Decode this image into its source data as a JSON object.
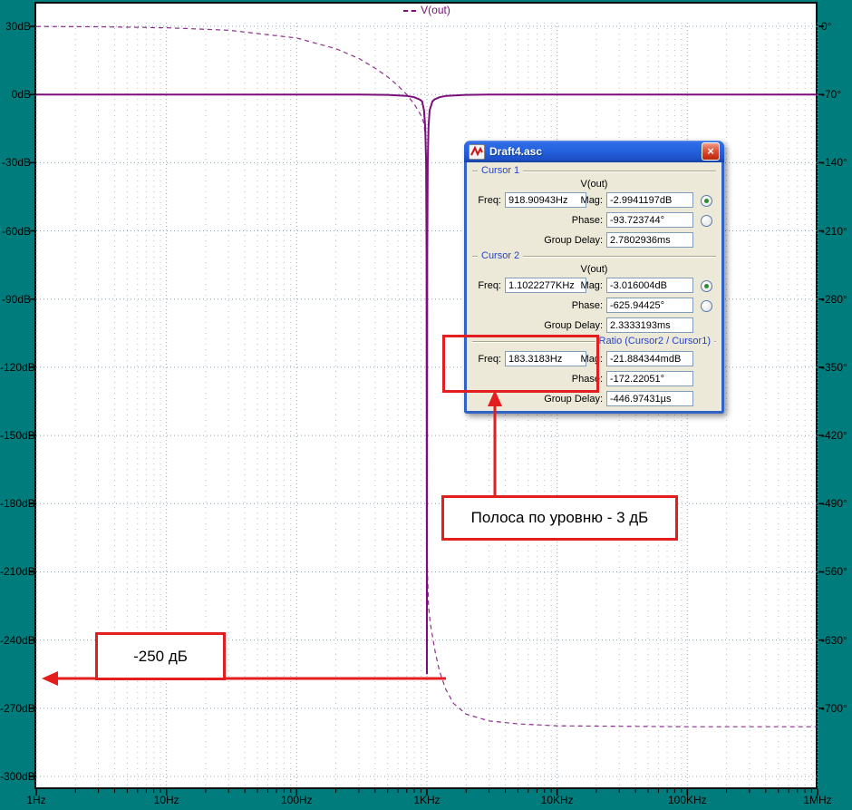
{
  "window": {
    "title": "Draft4.asc",
    "close_icon": "×"
  },
  "labels": {
    "freq": "Freq:",
    "mag": "Mag:",
    "phase": "Phase:",
    "group_delay": "Group Delay:"
  },
  "cursor1": {
    "section_label": "Cursor 1",
    "trace": "V(out)",
    "freq": "918.90943Hz",
    "mag": "-2.9941197dB",
    "mag_selected": true,
    "phase": "-93.723744°",
    "phase_selected": false,
    "group_delay": "2.7802936ms"
  },
  "cursor2": {
    "section_label": "Cursor 2",
    "trace": "V(out)",
    "freq": "1.1022277KHz",
    "mag": "-3.016004dB",
    "mag_selected": true,
    "phase": "-625.94425°",
    "phase_selected": false,
    "group_delay": "2.3333193ms"
  },
  "ratio": {
    "section_label": "Ratio (Cursor2 / Cursor1)",
    "freq": "183.3183Hz",
    "mag": "-21.884344mdB",
    "phase": "-172.22051°",
    "group_delay": "-446.97431µs"
  },
  "annotations": {
    "bandwidth_label": "Полоса по уровню - 3 дБ",
    "level_label": "-250 дБ"
  },
  "colors": {
    "background_teal": "#007C7C",
    "trace": "#7B0E7B",
    "trace_phase": "#8B2F8B",
    "annotation_red": "#E31E1E",
    "dialog_bg": "#ECE9D8",
    "section_header_blue": "#2743C9"
  },
  "chart_data": {
    "type": "line",
    "title": "V(out)",
    "x_axis": {
      "scale": "log",
      "range_hz": [
        1,
        1000000
      ],
      "ticks": [
        {
          "v": 1,
          "label": "1Hz"
        },
        {
          "v": 10,
          "label": "10Hz"
        },
        {
          "v": 100,
          "label": "100Hz"
        },
        {
          "v": 1000,
          "label": "1KHz"
        },
        {
          "v": 10000,
          "label": "10KHz"
        },
        {
          "v": 100000,
          "label": "100KHz"
        },
        {
          "v": 1000000,
          "label": "1MHz"
        }
      ]
    },
    "y_left": {
      "unit": "dB",
      "range": [
        30,
        -300
      ],
      "ticks": [
        {
          "v": 30,
          "label": "30dB"
        },
        {
          "v": 0,
          "label": "0dB"
        },
        {
          "v": -30,
          "label": "-30dB"
        },
        {
          "v": -60,
          "label": "-60dB"
        },
        {
          "v": -90,
          "label": "-90dB"
        },
        {
          "v": -120,
          "label": "-120dB"
        },
        {
          "v": -150,
          "label": "-150dB"
        },
        {
          "v": -180,
          "label": "-180dB"
        },
        {
          "v": -210,
          "label": "-210dB"
        },
        {
          "v": -240,
          "label": "-240dB"
        },
        {
          "v": -270,
          "label": "-270dB"
        },
        {
          "v": -300,
          "label": "-300dB"
        }
      ]
    },
    "y_right": {
      "unit": "degrees",
      "degrees_per_gridline": 70,
      "ticks": [
        {
          "v": 0,
          "label": "0°"
        },
        {
          "v": -70,
          "label": "-70°"
        },
        {
          "v": -140,
          "label": "-140°"
        },
        {
          "v": -210,
          "label": "-210°"
        },
        {
          "v": -280,
          "label": "-280°"
        },
        {
          "v": -350,
          "label": "-350°"
        },
        {
          "v": -420,
          "label": "-420°"
        },
        {
          "v": -490,
          "label": "-490°"
        },
        {
          "v": -560,
          "label": "-560°"
        },
        {
          "v": -630,
          "label": "-630°"
        },
        {
          "v": -700,
          "label": "-700°"
        }
      ]
    },
    "series": [
      {
        "name": "magnitude",
        "style": "solid",
        "color": "#7B0E7B",
        "unit": "dB",
        "points": [
          [
            1,
            0
          ],
          [
            10,
            0
          ],
          [
            100,
            0
          ],
          [
            300,
            -0.05
          ],
          [
            500,
            -0.15
          ],
          [
            700,
            -0.6
          ],
          [
            800,
            -1.2
          ],
          [
            880,
            -2.2
          ],
          [
            918.9,
            -2.99
          ],
          [
            950,
            -7
          ],
          [
            970,
            -14
          ],
          [
            985,
            -30
          ],
          [
            993,
            -70
          ],
          [
            997,
            -150
          ],
          [
            1000,
            -255
          ],
          [
            1003,
            -150
          ],
          [
            1007,
            -70
          ],
          [
            1015,
            -30
          ],
          [
            1030,
            -14
          ],
          [
            1050,
            -7
          ],
          [
            1102,
            -3.02
          ],
          [
            1140,
            -2.2
          ],
          [
            1250,
            -1.2
          ],
          [
            1400,
            -0.6
          ],
          [
            2000,
            -0.15
          ],
          [
            3000,
            -0.05
          ],
          [
            10000,
            0
          ],
          [
            100000,
            0
          ],
          [
            1000000,
            0
          ]
        ]
      },
      {
        "name": "phase",
        "style": "dashed",
        "color": "#8B2F8B",
        "unit": "degrees",
        "points": [
          [
            1,
            -0.2
          ],
          [
            3,
            -0.5
          ],
          [
            10,
            -1.5
          ],
          [
            30,
            -4
          ],
          [
            100,
            -12
          ],
          [
            200,
            -23
          ],
          [
            300,
            -33
          ],
          [
            400,
            -43
          ],
          [
            500,
            -52
          ],
          [
            600,
            -61
          ],
          [
            700,
            -70
          ],
          [
            800,
            -80
          ],
          [
            880,
            -89
          ],
          [
            918.9,
            -93.7
          ],
          [
            950,
            -100
          ],
          [
            975,
            -115
          ],
          [
            990,
            -140
          ],
          [
            996,
            -200
          ],
          [
            999,
            -300
          ],
          [
            1000,
            -380
          ],
          [
            1001,
            -450
          ],
          [
            1004,
            -520
          ],
          [
            1010,
            -560
          ],
          [
            1030,
            -595
          ],
          [
            1060,
            -612
          ],
          [
            1102,
            -625.9
          ],
          [
            1160,
            -643
          ],
          [
            1250,
            -662
          ],
          [
            1400,
            -681
          ],
          [
            1600,
            -695
          ],
          [
            2000,
            -706
          ],
          [
            3000,
            -713
          ],
          [
            5000,
            -716
          ],
          [
            10000,
            -718
          ],
          [
            100000,
            -719
          ],
          [
            1000000,
            -719
          ]
        ]
      }
    ]
  }
}
